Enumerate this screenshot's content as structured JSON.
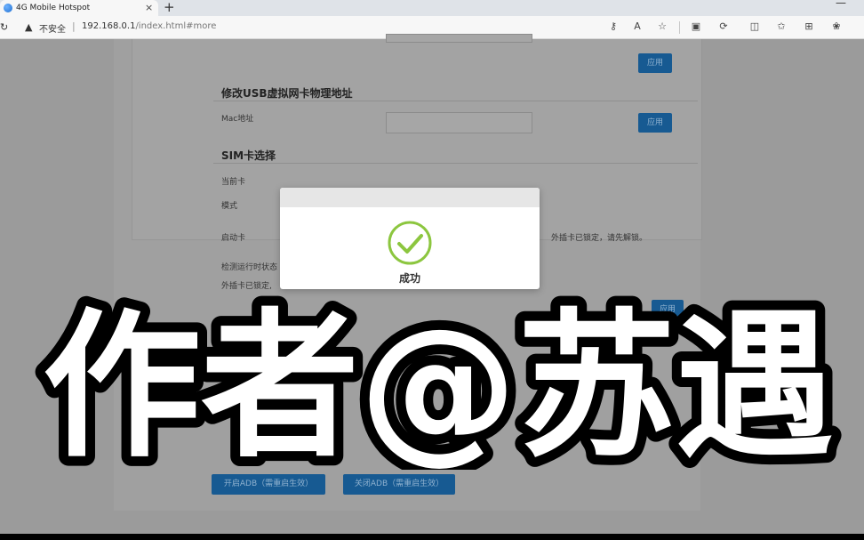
{
  "browser": {
    "tab_title": "4G Mobile Hotspot",
    "tab_close": "×",
    "new_tab": "+",
    "minimize": "—",
    "insecure_label": "不安全",
    "addr_sep": "|",
    "url_host": "192.168.0.1",
    "url_path": "/index.html#more",
    "toolbar_icons": [
      "key-icon",
      "read-aloud-icon",
      "favorite-star-icon",
      "app-icon",
      "extensions-icon",
      "split-screen-icon",
      "favorites-icon",
      "collections-icon",
      "copilot-icon"
    ]
  },
  "page": {
    "top_apply": "应用",
    "mac_section": {
      "title": "修改USB虚拟网卡物理地址",
      "label": "Mac地址",
      "value": "",
      "apply": "应用"
    },
    "sim_section": {
      "title": "SIM卡选择",
      "current_label": "当前卡",
      "mode_label": "模式",
      "boot_label": "启动卡",
      "locked_note": "外插卡已锁定，请先解锁。",
      "detect_label": "检测运行时状态",
      "detect_note": "外插卡已锁定,",
      "apply": "应用"
    },
    "adb": {
      "enable": "开启ADB（需重启生效）",
      "disable": "关闭ADB（需重启生效）"
    }
  },
  "modal": {
    "message": "成功",
    "icon": "success-check-icon",
    "accent": "#8cc63f"
  },
  "watermark": {
    "text": "作者@苏遇"
  }
}
